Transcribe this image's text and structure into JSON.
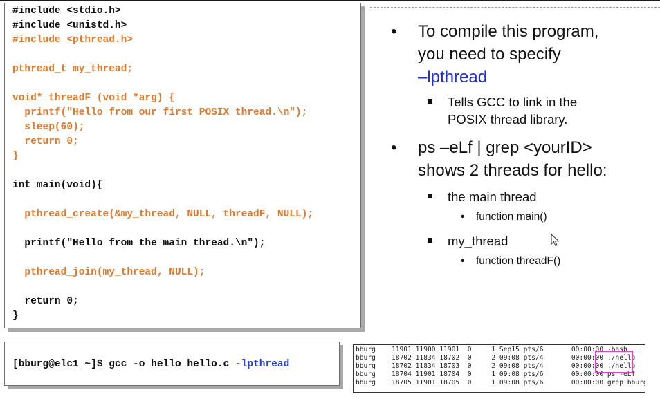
{
  "code": {
    "lines": [
      {
        "text": "#include <stdio.h>",
        "color": "black"
      },
      {
        "text": "#include <unistd.h>",
        "color": "black"
      },
      {
        "text": "#include <pthread.h>",
        "color": "orange"
      },
      {
        "text": "pthread_t my_thread;",
        "color": "orange"
      },
      {
        "text": "void* threadF (void *arg) {",
        "color": "orange"
      },
      {
        "text": "  printf(\"Hello from our first POSIX thread.\\n\");",
        "color": "orange"
      },
      {
        "text": "  sleep(60);",
        "color": "orange"
      },
      {
        "text": "  return 0;",
        "color": "orange"
      },
      {
        "text": "}",
        "color": "orange"
      },
      {
        "text": "int main(void){",
        "color": "black"
      },
      {
        "text": "  pthread_create(&my_thread, NULL, threadF, NULL);",
        "color": "orange"
      },
      {
        "text": "  printf(\"Hello from the main thread.\\n\");",
        "color": "black"
      },
      {
        "text": "  pthread_join(my_thread, NULL);",
        "color": "orange"
      },
      {
        "text": "  return 0;",
        "color": "black"
      },
      {
        "text": "}",
        "color": "black"
      }
    ]
  },
  "command": {
    "prompt": "[bburg@elc1 ~]$ gcc -o hello hello.c ",
    "flag": "-lpthread"
  },
  "bullets": {
    "compile_line1": "To compile this program,",
    "compile_line2": "you need to specify",
    "compile_flag": "–lpthread",
    "gcc_line1": "Tells GCC to link in the",
    "gcc_line2": "POSIX thread library.",
    "ps_line1": "ps –eLf | grep <yourID>",
    "ps_line2": "shows 2 threads for hello:",
    "main_thread": "the main thread",
    "main_fn": "function main()",
    "my_thread": "my_thread",
    "threadF_fn": "function threadF()"
  },
  "terminal": {
    "rows": [
      "bburg    11901 11900 11901  0     1 Sep15 pts/6       00:00:00 -bash",
      "bburg    18702 11834 18702  0     2 09:08 pts/4       00:00:00 ./hello",
      "bburg    18702 11834 18703  0     2 09:08 pts/4       00:00:00 ./hello",
      "bburg    18704 11901 18704  0     1 09:08 pts/6       00:00:00 ps -eLf",
      "bburg    18705 11901 18705  0     1 09:08 pts/6       00:00:00 grep bburg"
    ]
  },
  "colors": {
    "orange": "#e2792a",
    "blue": "#1f2fd6",
    "highlight": "#ea3bd1"
  }
}
